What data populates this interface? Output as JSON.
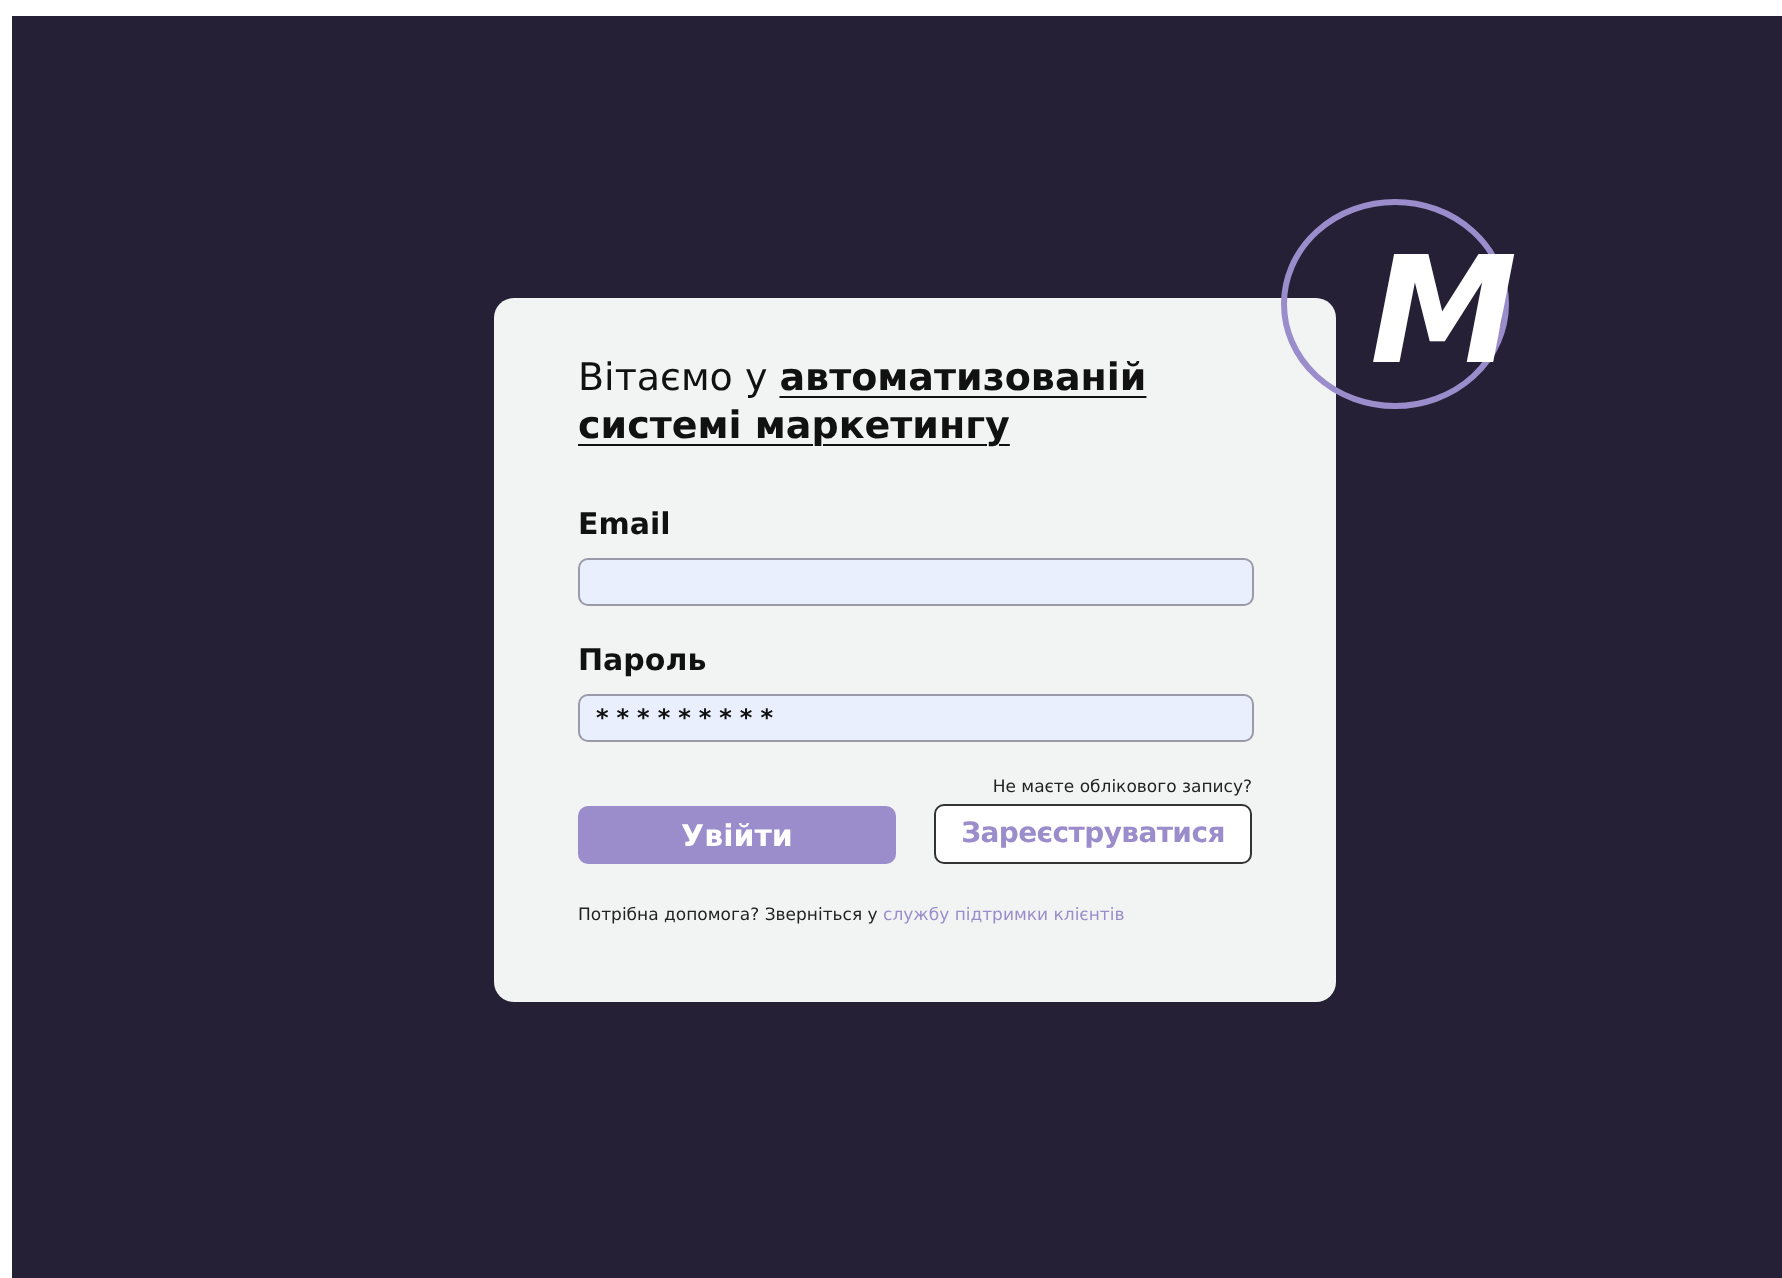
{
  "logo": {
    "letter": "M"
  },
  "heading": "Вітаємо у **автоматизованій системі маркетингу**",
  "fields": [
    {
      "label": "Email",
      "kind": "text"
    },
    {
      "label": "Пароль",
      "value": "*********",
      "kind": "password"
    }
  ],
  "login_button": "Увійти",
  "signup": {
    "prompt": "Не маєте облікового запису?",
    "button": "Зареєструватися"
  },
  "help": {
    "text": "Потрібна допомога? Зверніться у",
    "link": "службу підтримки клієнтів"
  }
}
